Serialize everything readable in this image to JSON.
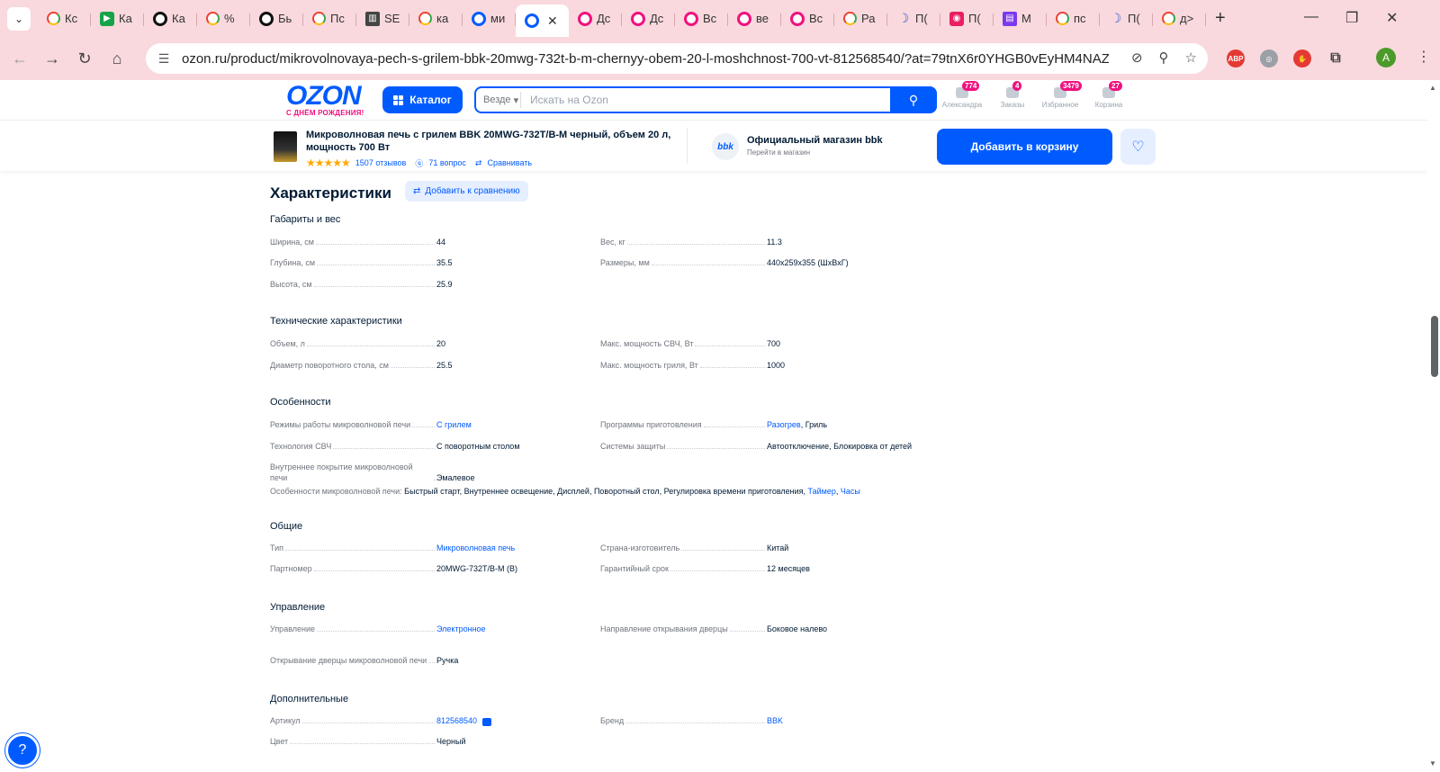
{
  "browser": {
    "tabs": [
      {
        "icon": "g",
        "label": "Кс"
      },
      {
        "icon": "green",
        "label": "Ка"
      },
      {
        "icon": "dark",
        "label": "Ка"
      },
      {
        "icon": "g",
        "label": "%"
      },
      {
        "icon": "dark",
        "label": "Бь"
      },
      {
        "icon": "g",
        "label": "Пс"
      },
      {
        "icon": "square",
        "label": "SE"
      },
      {
        "icon": "g",
        "label": "ка"
      },
      {
        "icon": "ozon",
        "label": "ми"
      },
      {
        "icon": "ozon",
        "label": "",
        "active": true
      },
      {
        "icon": "ozon-red",
        "label": "Дс"
      },
      {
        "icon": "ozon-red",
        "label": "Дс"
      },
      {
        "icon": "ozon-red",
        "label": "Вс"
      },
      {
        "icon": "ozon-red",
        "label": "ве"
      },
      {
        "icon": "ozon-red",
        "label": "Вс"
      },
      {
        "icon": "g",
        "label": "Ра"
      },
      {
        "icon": "moon",
        "label": "П("
      },
      {
        "icon": "pink",
        "label": "П("
      },
      {
        "icon": "purple",
        "label": "М"
      },
      {
        "icon": "g",
        "label": "пс"
      },
      {
        "icon": "moon",
        "label": "П("
      },
      {
        "icon": "g",
        "label": "д>"
      }
    ],
    "url": "ozon.ru/product/mikrovolnovaya-pech-s-grilem-bbk-20mwg-732t-b-m-chernyy-obem-20-l-moshchnost-700-vt-812568540/?at=79tnX6r0YHGB0vEyHM4NAZ...",
    "profile_initial": "A",
    "ext_abp": "ABP"
  },
  "header": {
    "logo": "OZON",
    "logo_sub": "С ДНЁМ РОЖДЕНИЯ!",
    "catalog": "Каталог",
    "search_scope": "Везде",
    "search_placeholder": "Искать на Ozon",
    "items": [
      {
        "label": "Александра",
        "badge": "774"
      },
      {
        "label": "Заказы",
        "badge": "4"
      },
      {
        "label": "Избранное",
        "badge": "3479"
      },
      {
        "label": "Корзина",
        "badge": "27"
      }
    ]
  },
  "product_bar": {
    "title": "Микроволновая печь с грилем BBK 20MWG-732T/B-M черный, объем 20 л, мощность 700 Вт",
    "reviews": "1507 отзывов",
    "questions": "71 вопрос",
    "compare": "Сравнивать",
    "shop_logo": "bbk",
    "shop_name": "Официальный магазин bbk",
    "shop_link": "Перейти в магазин",
    "cart_button": "Добавить в корзину",
    "rating": 5
  },
  "characteristics": {
    "title": "Характеристики",
    "compare_button": "Добавить к сравнению",
    "sections": {
      "dims": {
        "title": "Габариты и вес",
        "left": [
          {
            "k": "Ширина, см",
            "v": "44"
          },
          {
            "k": "Глубина, см",
            "v": "35.5"
          },
          {
            "k": "Высота, см",
            "v": "25.9"
          }
        ],
        "right": [
          {
            "k": "Вес, кг",
            "v": "11.3"
          },
          {
            "k": "Размеры, мм",
            "v": "440x259x355 (ШxВxГ)"
          }
        ]
      },
      "tech": {
        "title": "Технические характеристики",
        "left": [
          {
            "k": "Объем, л",
            "v": "20"
          },
          {
            "k": "Диаметр поворотного стола, см",
            "v": "25.5"
          }
        ],
        "right": [
          {
            "k": "Макс. мощность СВЧ, Вт",
            "v": "700"
          },
          {
            "k": "Макс. мощность гриля, Вт",
            "v": "1000"
          }
        ]
      },
      "features": {
        "title": "Особенности",
        "left": [
          {
            "k": "Режимы работы микроволновой печи",
            "v": "С грилем"
          },
          {
            "k": "Технология СВЧ",
            "v": "С поворотным столом"
          },
          {
            "k": "Внутреннее покрытие микроволновой печи",
            "v": "Эмалевое"
          }
        ],
        "right": [
          {
            "k": "Программы приготовления",
            "v1": "Разогрев",
            "v2": ", Гриль"
          },
          {
            "k": "Системы защиты",
            "v": "Автоотключение, Блокировка от детей"
          }
        ],
        "inline_key": "Особенности микроволновой печи:",
        "inline_value": " Быстрый старт, Внутреннее освещение, Дисплей, Поворотный стол, Регулировка времени приготовления, ",
        "inline_link1": "Таймер",
        "inline_sep": ", ",
        "inline_link2": "Часы"
      },
      "general": {
        "title": "Общие",
        "left": [
          {
            "k": "Тип",
            "v": "Микроволновая печь"
          },
          {
            "k": "Партномер",
            "v": "20MWG-732T/B-M (B)"
          }
        ],
        "right": [
          {
            "k": "Страна-изготовитель",
            "v": "Китай"
          },
          {
            "k": "Гарантийный срок",
            "v": "12 месяцев"
          }
        ]
      },
      "control": {
        "title": "Управление",
        "left": [
          {
            "k": "Управление",
            "v": "Электронное"
          },
          {
            "k": "Открывание дверцы микроволновой печи",
            "v": "Ручка"
          }
        ],
        "right": [
          {
            "k": "Направление открывания дверцы",
            "v": "Боковое налево"
          }
        ]
      },
      "extra": {
        "title": "Дополнительные",
        "left": [
          {
            "k": "Артикул",
            "v": "812568540"
          },
          {
            "k": "Цвет",
            "v": "Черный"
          }
        ],
        "right": [
          {
            "k": "Бренд",
            "v": "BBK"
          }
        ]
      }
    }
  },
  "colors": {
    "brand_blue": "#005bff",
    "brand_pink": "#f1117e",
    "chrome": "#f9d9dd"
  }
}
